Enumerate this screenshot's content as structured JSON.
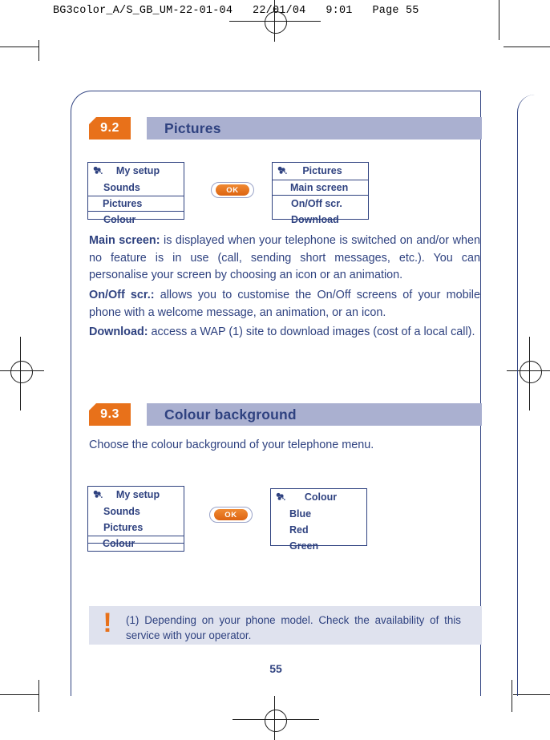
{
  "print_slug": "BG3color_A/S_GB_UM-22-01-04   22/01/04   9:01   Page 55",
  "colors": {
    "ink_blue": "#2f4280",
    "accent_orange": "#e8711a",
    "header_band": "#aab0d0",
    "footnote_bg": "#dfe2ee"
  },
  "sections": [
    {
      "number": "9.2",
      "title": "Pictures",
      "paragraphs": [
        {
          "lead": "Main screen:",
          "text": " is displayed when your telephone is switched on and/or when no feature is in use (call, sending short messages, etc.). You can personalise your screen by choosing an icon or an animation."
        },
        {
          "lead": "On/Off scr.:",
          "text": " allows you to customise the On/Off screens of your mobile phone with a welcome message, an animation, or an icon."
        },
        {
          "lead": "Download:",
          "text": " access a WAP (1) site to download images (cost of a local call)."
        }
      ],
      "nav": {
        "left_screen": {
          "icon": "my-setup-icon",
          "title": "My setup",
          "items": [
            {
              "label": "Sounds",
              "selected": false
            },
            {
              "label": "Pictures",
              "selected": true
            },
            {
              "label": "Colour",
              "selected": false
            }
          ]
        },
        "button": {
          "label": "OK"
        },
        "right_screen": {
          "icon": "my-setup-icon",
          "title": "Pictures",
          "items": [
            {
              "label": "Main screen",
              "selected": true
            },
            {
              "label": "On/Off scr.",
              "selected": false
            },
            {
              "label": "Download",
              "selected": false
            }
          ]
        }
      }
    },
    {
      "number": "9.3",
      "title": "Colour background",
      "paragraphs": [
        {
          "lead": "",
          "text": "Choose the colour background of your telephone menu."
        }
      ],
      "nav": {
        "left_screen": {
          "icon": "my-setup-icon",
          "title": "My setup",
          "items": [
            {
              "label": "Sounds",
              "selected": false
            },
            {
              "label": "Pictures",
              "selected": false
            },
            {
              "label": "Colour",
              "selected": true
            }
          ]
        },
        "button": {
          "label": "OK"
        },
        "right_screen": {
          "icon": "my-setup-icon",
          "title": "Colour",
          "items": [
            {
              "label": "Blue",
              "selected": false
            },
            {
              "label": "Red",
              "selected": false
            },
            {
              "label": "Green",
              "selected": false
            }
          ]
        }
      }
    }
  ],
  "footnote": {
    "marker": "!",
    "number": "(1)",
    "text": "Depending on your phone model. Check the availability of this service with your operator."
  },
  "page_number": "55"
}
